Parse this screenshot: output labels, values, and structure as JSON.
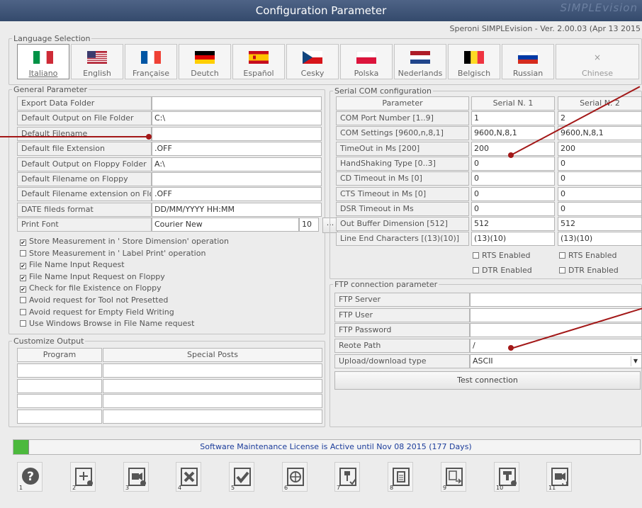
{
  "window": {
    "title": "Configuration Parameter",
    "ghost_title": "SIMPLEvision",
    "version": "Speroni SIMPLEvision - Ver. 2.00.03 (Apr 13 2015"
  },
  "language": {
    "legend": "Language Selection",
    "items": [
      {
        "label": "Italiano",
        "flag": "italy-flag-icon",
        "selected": true
      },
      {
        "label": "English",
        "flag": "usa-flag-icon"
      },
      {
        "label": "Française",
        "flag": "france-flag-icon"
      },
      {
        "label": "Deutch",
        "flag": "germany-flag-icon"
      },
      {
        "label": "Español",
        "flag": "spain-flag-icon"
      },
      {
        "label": "Cesky",
        "flag": "czech-flag-icon"
      },
      {
        "label": "Polska",
        "flag": "poland-flag-icon"
      },
      {
        "label": "Nederlands",
        "flag": "netherlands-flag-icon"
      },
      {
        "label": "Belgisch",
        "flag": "belgium-flag-icon"
      },
      {
        "label": "Russian",
        "flag": "russia-flag-icon"
      },
      {
        "label": "Chinese",
        "flag": "close-icon"
      }
    ]
  },
  "general": {
    "legend": "General Parameter",
    "rows": [
      {
        "label": "Export Data Folder",
        "value": ""
      },
      {
        "label": "Default Output on File Folder",
        "value": "C:\\"
      },
      {
        "label": "Default Filename",
        "value": ""
      },
      {
        "label": "Default file Extension",
        "value": ".OFF"
      },
      {
        "label": "Default Output on Floppy Folder",
        "value": "A:\\"
      },
      {
        "label": "Default Filename on Floppy",
        "value": ""
      },
      {
        "label": "Default Filename extension on Floppy",
        "value": ".OFF"
      },
      {
        "label": "DATE fileds format",
        "value": "DD/MM/YYYY HH:MM"
      }
    ],
    "print_font": {
      "label": "Print Font",
      "value": "Courier New",
      "size": "10",
      "browse": "..."
    },
    "checks": [
      {
        "label": "Store Measurement in ' Store Dimension' operation",
        "checked": "✔"
      },
      {
        "label": "Store Measurement in ' Label Print' operation",
        "checked": ""
      },
      {
        "label": "File Name Input Request",
        "checked": "✔"
      },
      {
        "label": "File Name Input Request on Floppy",
        "checked": "✔"
      },
      {
        "label": "Check for file Existence on Floppy",
        "checked": "✔"
      },
      {
        "label": "Avoid request for Tool not Presetted",
        "checked": ""
      },
      {
        "label": "Avoid request for Empty Field Writing",
        "checked": ""
      },
      {
        "label": "Use Windows Browse in File Name request",
        "checked": ""
      }
    ]
  },
  "serial": {
    "legend": "Serial COM configuration",
    "headers": [
      "Parameter",
      "Serial N. 1",
      "Serial N. 2"
    ],
    "rows": [
      {
        "label": "COM Port Number [1..9]",
        "s1": "1",
        "s2": "2"
      },
      {
        "label": "COM Settings [9600,n,8,1]",
        "s1": "9600,N,8,1",
        "s2": "9600,N,8,1"
      },
      {
        "label": "TimeOut in Ms [200]",
        "s1": "200",
        "s2": "200"
      },
      {
        "label": "HandShaking Type [0..3]",
        "s1": "0",
        "s2": "0"
      },
      {
        "label": "CD Timeout in Ms [0]",
        "s1": "0",
        "s2": "0"
      },
      {
        "label": "CTS Timeout in Ms [0]",
        "s1": "0",
        "s2": "0"
      },
      {
        "label": "DSR Timeout in Ms",
        "s1": "0",
        "s2": "0"
      },
      {
        "label": "Out Buffer Dimension [512]",
        "s1": "512",
        "s2": "512"
      },
      {
        "label": "Line End Characters [(13)(10)]",
        "s1": "(13)(10)",
        "s2": "(13)(10)"
      }
    ],
    "rts": "RTS Enabled",
    "dtr": "DTR Enabled"
  },
  "ftp": {
    "legend": "FTP connection  parameter",
    "rows": [
      {
        "label": "FTP Server",
        "value": ""
      },
      {
        "label": "FTP User",
        "value": ""
      },
      {
        "label": "FTP Password",
        "value": ""
      },
      {
        "label": "Reote Path",
        "value": "/"
      }
    ],
    "type_label": "Upload/download type",
    "type_value": "ASCII",
    "test_button": "Test connection"
  },
  "customize": {
    "legend": "Customize Output",
    "col1": "Program",
    "col2": "Special Posts"
  },
  "status": {
    "message": "Software Maintenance License is Active until Nov 08 2015 (177 Days)",
    "led_color": "#4cb93d"
  },
  "toolbar": [
    {
      "num": "1",
      "icon": "help-icon"
    },
    {
      "num": "2",
      "icon": "add-settings-icon"
    },
    {
      "num": "3",
      "icon": "camera-settings-icon"
    },
    {
      "num": "4",
      "icon": "cancel-icon"
    },
    {
      "num": "5",
      "icon": "confirm-icon"
    },
    {
      "num": "6",
      "icon": "network-icon"
    },
    {
      "num": "7",
      "icon": "tool-check-icon"
    },
    {
      "num": "8",
      "icon": "document-icon"
    },
    {
      "num": "9",
      "icon": "file-transfer-icon"
    },
    {
      "num": "10",
      "icon": "machine-settings-icon"
    },
    {
      "num": "11",
      "icon": "camera-sync-icon"
    }
  ]
}
